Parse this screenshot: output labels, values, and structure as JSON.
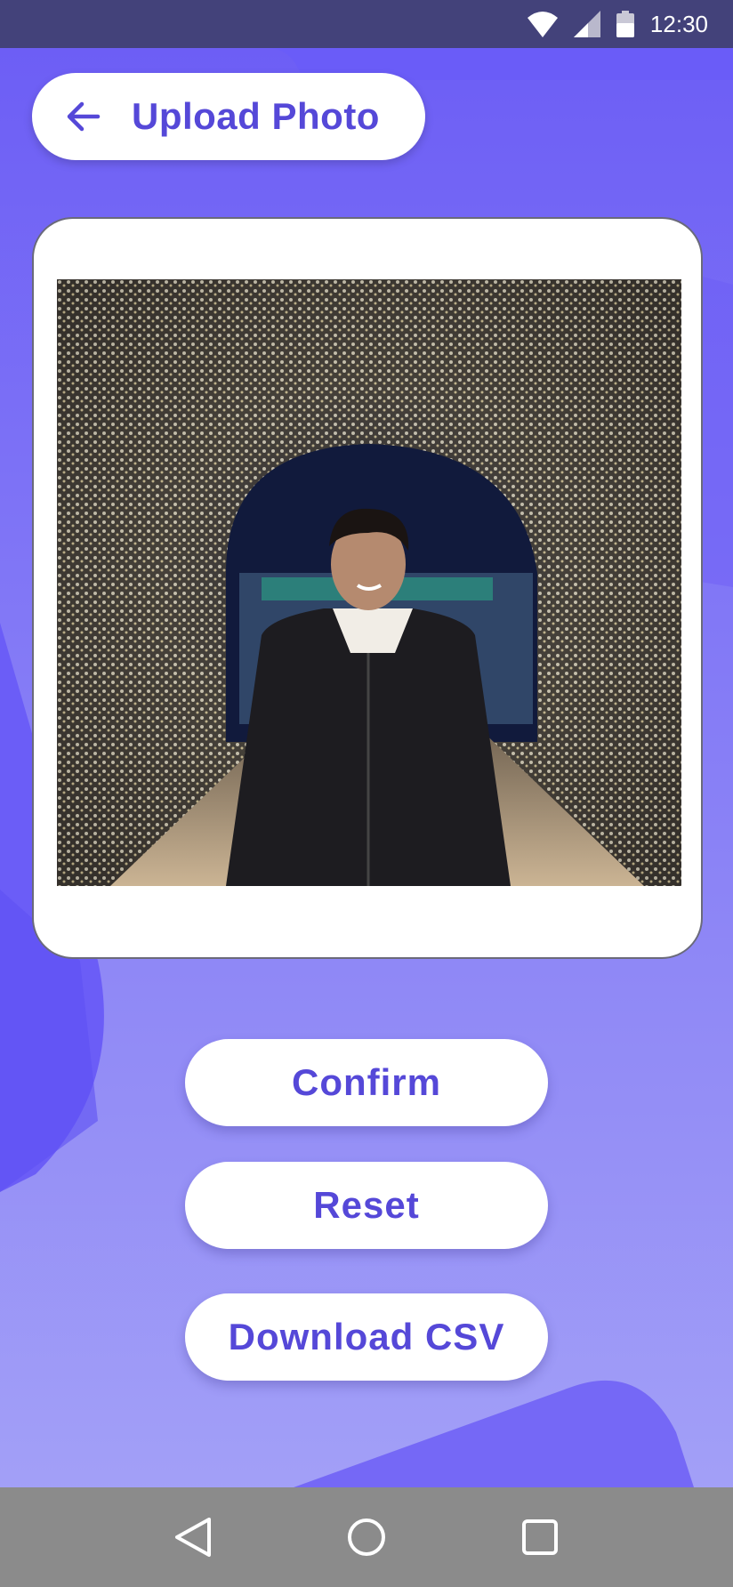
{
  "status_bar": {
    "time": "12:30",
    "icons": [
      "wifi-icon",
      "cellular-signal-icon",
      "battery-icon"
    ]
  },
  "header": {
    "back_icon": "arrow-left-icon",
    "title": "Upload Photo"
  },
  "photo_card": {
    "image_description_icon": "photo-preview"
  },
  "actions": {
    "confirm_label": "Confirm",
    "reset_label": "Reset",
    "download_label": "Download CSV"
  },
  "nav_bar": {
    "icons": [
      "nav-back-icon",
      "nav-home-icon",
      "nav-recents-icon"
    ]
  },
  "colors": {
    "accent": "#5548d8",
    "background": "#8f8cf3",
    "status_bar": "#43427a",
    "nav_bar": "#8b8b8b"
  }
}
